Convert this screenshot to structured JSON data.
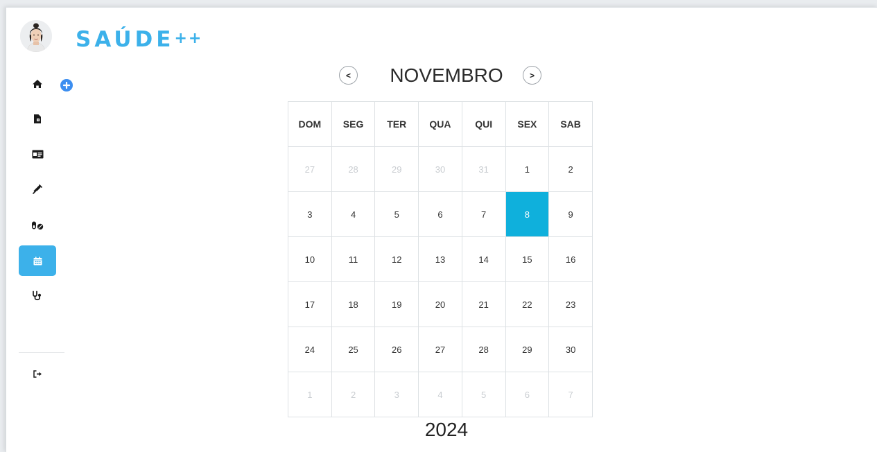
{
  "brand": {
    "name": "SAÚDE",
    "suffix": "++"
  },
  "colors": {
    "accent": "#3cb1ea",
    "today": "#0fb0dc",
    "add_button": "#3c8ef0"
  },
  "sidebar": {
    "items": [
      {
        "icon": "home-icon",
        "active": false
      },
      {
        "icon": "document-icon",
        "active": false
      },
      {
        "icon": "id-card-icon",
        "active": false
      },
      {
        "icon": "syringe-icon",
        "active": false
      },
      {
        "icon": "pills-icon",
        "active": false
      },
      {
        "icon": "calendar-icon",
        "active": true
      },
      {
        "icon": "stethoscope-icon",
        "active": false
      }
    ],
    "logout_icon": "logout-icon",
    "add_icon": "plus-circle-icon"
  },
  "calendar": {
    "prev_label": "<",
    "next_label": ">",
    "month": "NOVEMBRO",
    "year": "2024",
    "weekdays": [
      "DOM",
      "SEG",
      "TER",
      "QUA",
      "QUI",
      "SEX",
      "SAB"
    ],
    "weeks": [
      [
        {
          "d": "27",
          "muted": true
        },
        {
          "d": "28",
          "muted": true
        },
        {
          "d": "29",
          "muted": true
        },
        {
          "d": "30",
          "muted": true
        },
        {
          "d": "31",
          "muted": true
        },
        {
          "d": "1"
        },
        {
          "d": "2"
        }
      ],
      [
        {
          "d": "3"
        },
        {
          "d": "4"
        },
        {
          "d": "5"
        },
        {
          "d": "6"
        },
        {
          "d": "7"
        },
        {
          "d": "8",
          "today": true
        },
        {
          "d": "9"
        }
      ],
      [
        {
          "d": "10"
        },
        {
          "d": "11"
        },
        {
          "d": "12"
        },
        {
          "d": "13"
        },
        {
          "d": "14"
        },
        {
          "d": "15"
        },
        {
          "d": "16"
        }
      ],
      [
        {
          "d": "17"
        },
        {
          "d": "18"
        },
        {
          "d": "19"
        },
        {
          "d": "20"
        },
        {
          "d": "21"
        },
        {
          "d": "22"
        },
        {
          "d": "23"
        }
      ],
      [
        {
          "d": "24"
        },
        {
          "d": "25"
        },
        {
          "d": "26"
        },
        {
          "d": "27"
        },
        {
          "d": "28"
        },
        {
          "d": "29"
        },
        {
          "d": "30"
        }
      ],
      [
        {
          "d": "1",
          "muted": true
        },
        {
          "d": "2",
          "muted": true
        },
        {
          "d": "3",
          "muted": true
        },
        {
          "d": "4",
          "muted": true
        },
        {
          "d": "5",
          "muted": true
        },
        {
          "d": "6",
          "muted": true
        },
        {
          "d": "7",
          "muted": true
        }
      ]
    ]
  }
}
